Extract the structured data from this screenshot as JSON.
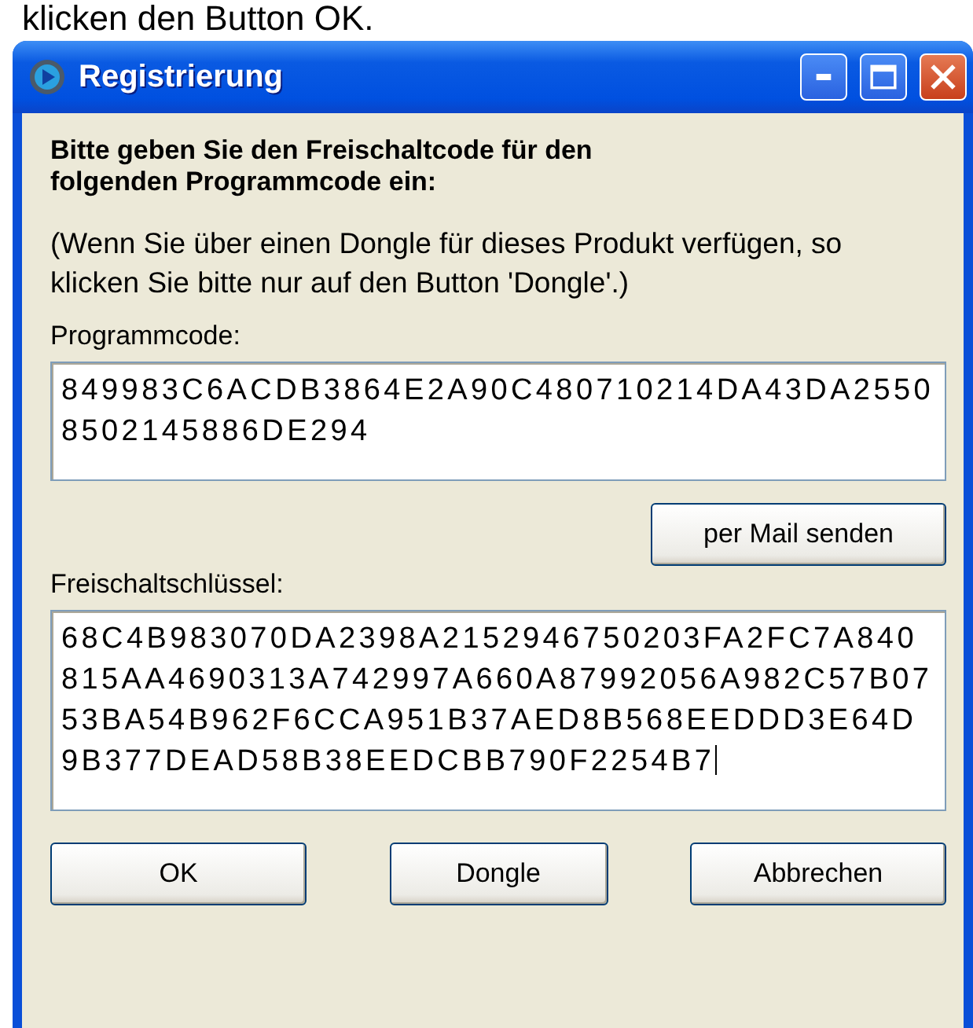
{
  "caption": "klicken den Button OK.",
  "window": {
    "title": "Registrierung",
    "controls": [
      {
        "kind": "minimize"
      },
      {
        "kind": "maximize"
      },
      {
        "kind": "close"
      }
    ]
  },
  "heading": "Bitte geben Sie den Freischaltcode für den folgenden Programmcode ein:",
  "note": "(Wenn Sie über einen Dongle für dieses Produkt verfügen, so klicken Sie bitte nur auf den Button 'Dongle'.)",
  "program_code": {
    "label": "Programmcode:",
    "value": "849983C6ACDB3864E2A90C480710214DA43DA25508502145886DE294",
    "focused": false
  },
  "mail_button": "per Mail senden",
  "unlock_key": {
    "label": "Freischaltschlüssel:",
    "value": "68C4B983070DA2398A2152946750203FA2FC7A840815AA4690313A742997A660A87992056A982C57B0753BA54B962F6CCA951B37AED8B568EEDDD3E64D9B377DEAD58B38EEDCBB790F2254B7",
    "focused": true
  },
  "buttons": [
    "OK",
    "Dongle",
    "Abbrechen"
  ]
}
